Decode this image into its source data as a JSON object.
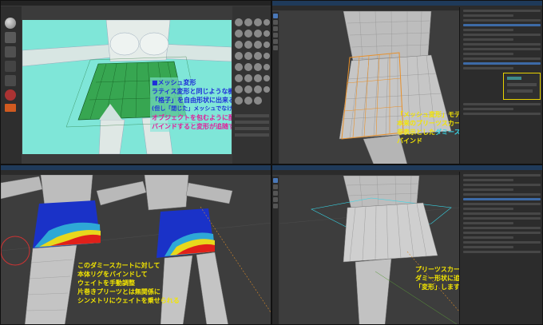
{
  "panels": {
    "zbrush": {
      "caption": {
        "title": "■メッシュ変形",
        "lines": [
          "ラティス変形と同じような機能ながら",
          "「格子」を自由形状に出来る",
          "(但し「閉じた」メッシュでなければならない)",
          "オブジェクトを包むように配置して",
          "バインドすると変形が追随する"
        ]
      }
    },
    "blender_top": {
      "caption": {
        "line1_a": "「メッシュ変形」",
        "line1_b": "モディファイアで",
        "line2": "本来のプリーツスカートに",
        "line3_a": "非表示とした",
        "line3_b": "ダミースカート",
        "line3_c": "を",
        "line4": "バインド"
      }
    },
    "blender_bottom_left": {
      "caption": {
        "lines": [
          "このダミースカートに対して",
          "本体リグをバインドして",
          "ウェイトを手動調整",
          "片巻きプリーツとは無関係に",
          "シンメトリにウェイトを乗せられる"
        ]
      }
    },
    "blender_bottom_right": {
      "caption": {
        "lines": [
          "プリーツスカートが",
          "ダミー形状に追随して",
          "「変形」します"
        ]
      }
    }
  },
  "colors": {
    "caption_yellow": "#f4e600",
    "caption_blue": "#1f2fd8",
    "caption_pink": "#e0209a",
    "caption_cyan": "#37d7e8",
    "zbrush_bg": "#7fe6d8",
    "orange_wire": "#e8902a",
    "highlight_yellow": "#e8d200"
  }
}
